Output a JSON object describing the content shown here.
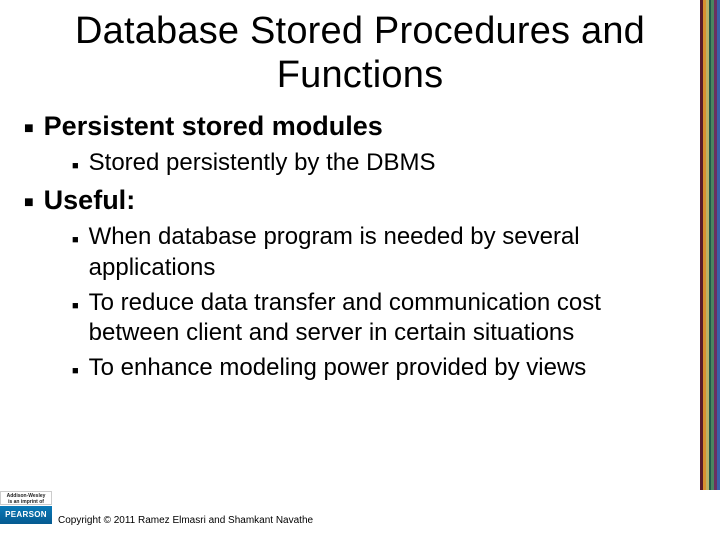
{
  "title": "Database Stored Procedures and Functions",
  "bullets": [
    {
      "text": "Persistent stored modules",
      "children": [
        {
          "text": "Stored persistently by the DBMS"
        }
      ]
    },
    {
      "text": "Useful:",
      "children": [
        {
          "text": "When database program is needed by several applications"
        },
        {
          "text": "To reduce data transfer and communication cost between client and server in certain situations"
        },
        {
          "text": "To enhance modeling power provided by views"
        }
      ]
    }
  ],
  "publisher": {
    "imprint_line1": "Addison-Wesley",
    "imprint_line2": "is an imprint of",
    "brand": "PEARSON"
  },
  "copyright": "Copyright © 2011 Ramez Elmasri and Shamkant Navathe"
}
